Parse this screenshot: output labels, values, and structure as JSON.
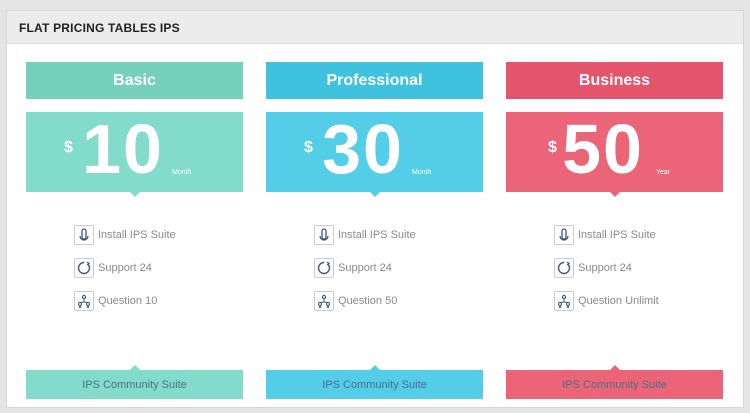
{
  "header": {
    "title": "FLAT PRICING TABLES IPS"
  },
  "plans": [
    {
      "name": "Basic",
      "currency": "$",
      "amount": "10",
      "period": "Month",
      "features": [
        "Install IPS Suite",
        "Support 24",
        "Question 10"
      ],
      "cta": "IPS Community Suite",
      "colors": {
        "title_bg": "#77cfbd",
        "price_bg": "#83dccb",
        "cta_bg": "#83dccb"
      }
    },
    {
      "name": "Professional",
      "currency": "$",
      "amount": "30",
      "period": "Month",
      "features": [
        "Install IPS Suite",
        "Support 24",
        "Question 50"
      ],
      "cta": "IPS Community Suite",
      "colors": {
        "title_bg": "#3fc2dd",
        "price_bg": "#53cde8",
        "cta_bg": "#53cde8"
      }
    },
    {
      "name": "Business",
      "currency": "$",
      "amount": "50",
      "period": "Year",
      "features": [
        "Install IPS Suite",
        "Support 24",
        "Question Unlimit"
      ],
      "cta": "IPS Community Suite",
      "colors": {
        "title_bg": "#e4546b",
        "price_bg": "#ec6478",
        "cta_bg": "#ec6478"
      }
    }
  ],
  "feature_icons": [
    "install-icon",
    "support-icon",
    "question-icon"
  ]
}
